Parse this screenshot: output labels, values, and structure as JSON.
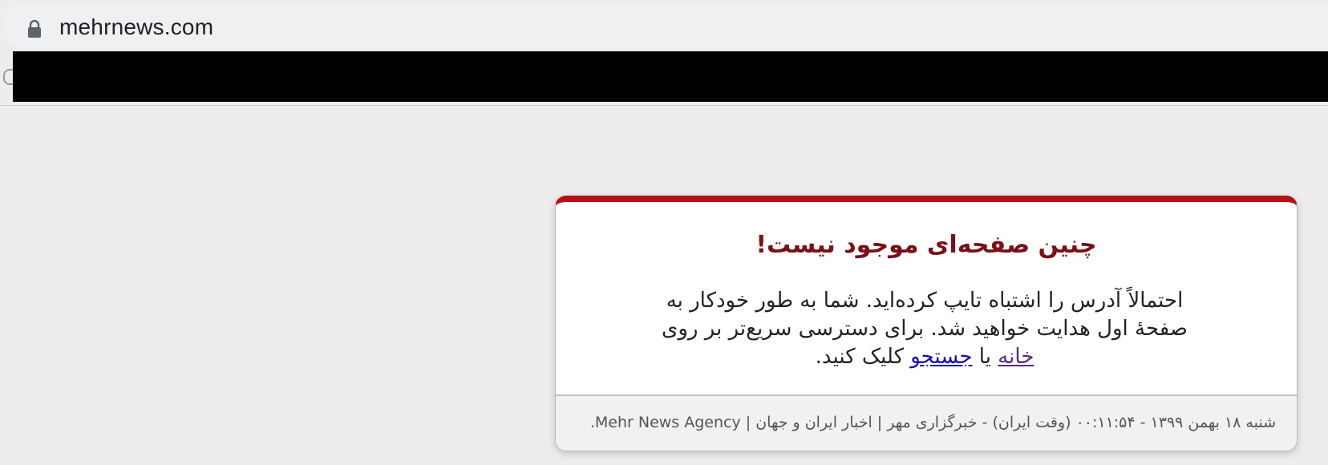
{
  "browser": {
    "url": "mehrnews.com",
    "lock_icon": "lock-icon"
  },
  "error_card": {
    "title": "چنین صفحه‌ای موجود نیست!",
    "message_part1": "احتمالاً آدرس را اشتباه تایپ کرده‌اید. شما به طور خودکار به صفحهٔ اول هدایت خواهید شد. برای دسترسی سریع‌تر بر روی ",
    "home_link": "خانه",
    "message_or": " یا ",
    "search_link": "جستجو",
    "message_end": " کلیک کنید.",
    "footer": "شنبه ۱۸ بهمن ۱۳۹۹ - ۰۰:۱۱:۵۴ (وقت ایران) - خبرگزاری مهر | اخبار ایران و جهان | Mehr News Agency."
  },
  "colors": {
    "accent_red": "#b31217",
    "title_color": "#7a1018",
    "page_bg": "#ededed"
  }
}
